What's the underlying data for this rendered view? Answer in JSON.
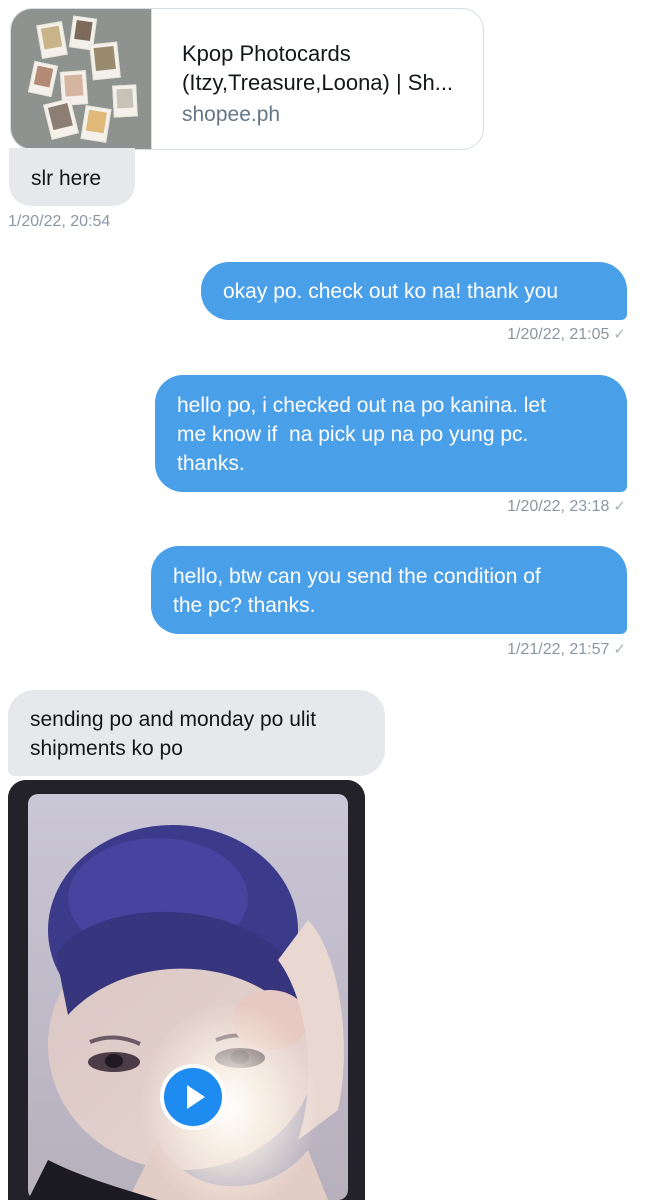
{
  "link_preview": {
    "title_line1": "Kpop Photocards",
    "title_line2": "(Itzy,Treasure,Loona) | Sh...",
    "domain": "shopee.ph"
  },
  "messages": [
    {
      "direction": "received",
      "text": "slr here",
      "timestamp": "1/20/22, 20:54"
    },
    {
      "direction": "sent",
      "text": "okay po. check out ko na! thank you",
      "timestamp": "1/20/22, 21:05",
      "status": "✓"
    },
    {
      "direction": "sent",
      "lines": [
        "hello po, i checked out na po kanina. let",
        "me know if  na pick up na po yung pc.",
        "thanks."
      ],
      "timestamp": "1/20/22, 23:18",
      "status": "✓"
    },
    {
      "direction": "sent",
      "lines": [
        "hello, btw can you send the condition of",
        "the pc? thanks."
      ],
      "timestamp": "1/21/22, 21:57",
      "status": "✓"
    },
    {
      "direction": "received",
      "lines": [
        "sending po and monday po ulit",
        "shipments ko po"
      ]
    }
  ],
  "media": {
    "type": "video",
    "play_icon": "play-icon"
  },
  "colors": {
    "sent_bubble": "#4a9fe9",
    "received_bubble": "#e6e8eb",
    "play_button": "#1d8bf0"
  }
}
